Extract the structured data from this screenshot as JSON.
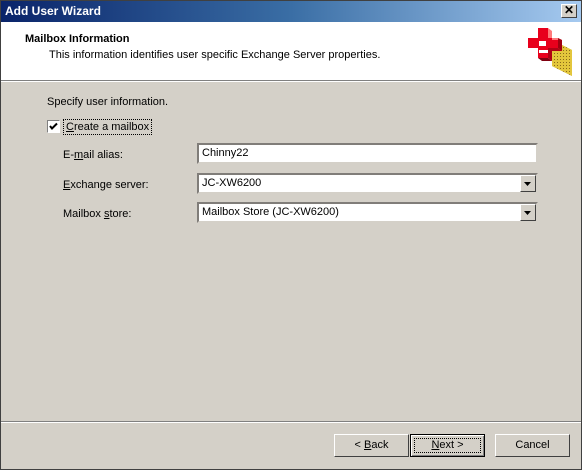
{
  "window": {
    "title": "Add User Wizard",
    "close_glyph": "✕"
  },
  "header": {
    "title": "Mailbox Information",
    "subtitle": "This information identifies user specific Exchange Server properties.",
    "logo_icon": "exchange-wizard-icon"
  },
  "form": {
    "instruction": "Specify user information.",
    "create_mailbox": {
      "label_accel": "C",
      "label_rest": "reate a mailbox",
      "checked": true
    },
    "alias": {
      "label_pre": "E-",
      "label_accel": "m",
      "label_post": "ail alias:",
      "value": "Chinny22"
    },
    "server": {
      "label_accel": "E",
      "label_rest": "xchange server:",
      "value": "JC-XW6200"
    },
    "store": {
      "label_pre": "Mailbox ",
      "label_accel": "s",
      "label_post": "tore:",
      "value": "Mailbox Store (JC-XW6200)"
    }
  },
  "buttons": {
    "back": {
      "prefix": "< ",
      "accel": "B",
      "rest": "ack"
    },
    "next": {
      "accel": "N",
      "rest": "ext",
      "suffix": " >"
    },
    "cancel": {
      "label": "Cancel"
    }
  },
  "colors": {
    "titlebar_start": "#0a246a",
    "face": "#d4d0c8",
    "logo_red": "#e8001c"
  }
}
